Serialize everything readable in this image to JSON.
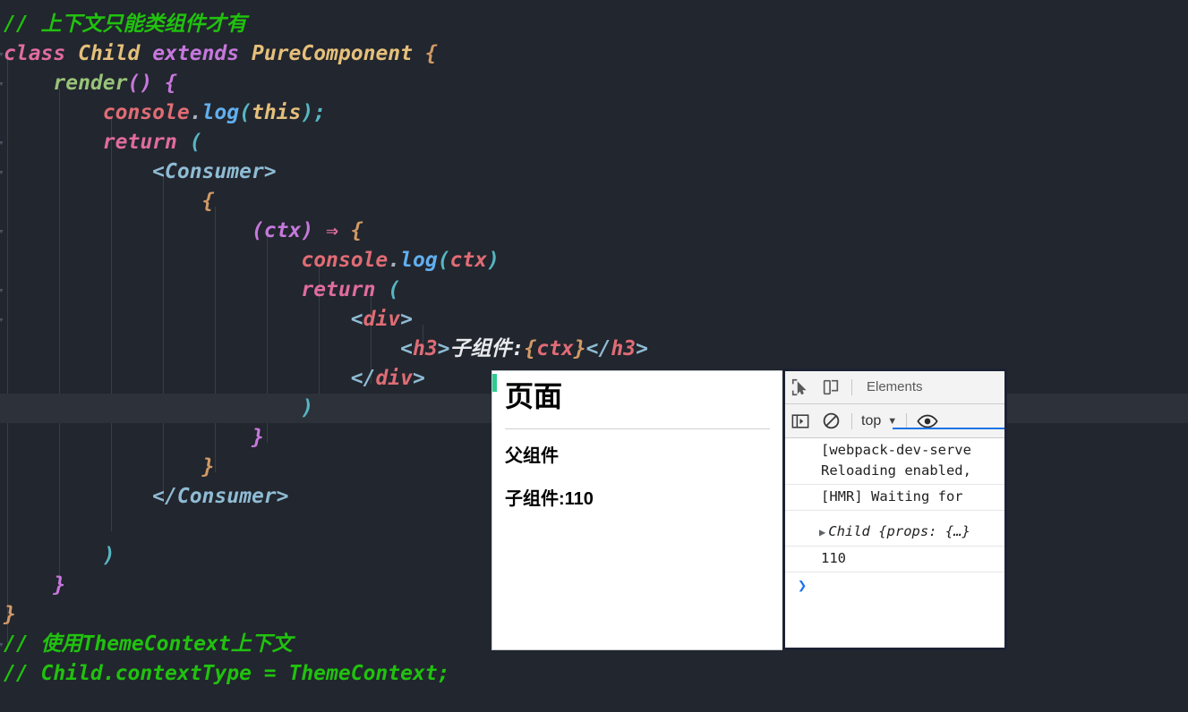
{
  "editor": {
    "theme": "One Dark",
    "bg": "#22262e",
    "highlight_bg": "#2c313a",
    "lines": [
      {
        "n": 0,
        "clipped": true,
        "fold": false,
        "tokens": []
      },
      {
        "n": 1,
        "fold": false,
        "tokens": [
          {
            "t": "// 上下文只能类组件才有",
            "c": "t-com"
          }
        ]
      },
      {
        "n": 2,
        "fold": true,
        "tokens": [
          {
            "t": "class ",
            "c": "t-kw"
          },
          {
            "t": "Child ",
            "c": "t-cls"
          },
          {
            "t": "extends ",
            "c": "t-kw2"
          },
          {
            "t": "PureComponent ",
            "c": "t-cls"
          },
          {
            "t": "{",
            "c": "t-brace"
          }
        ]
      },
      {
        "n": 3,
        "fold": true,
        "tokens": [
          {
            "t": "    ",
            "c": "t-punc"
          },
          {
            "t": "render",
            "c": "t-fn-green"
          },
          {
            "t": "()",
            "c": "t-brace2"
          },
          {
            "t": " ",
            "c": "t-punc"
          },
          {
            "t": "{",
            "c": "t-brace2"
          }
        ]
      },
      {
        "n": 4,
        "fold": false,
        "tokens": [
          {
            "t": "        ",
            "c": "t-punc"
          },
          {
            "t": "console",
            "c": "t-obj"
          },
          {
            "t": ".",
            "c": "t-punc"
          },
          {
            "t": "log",
            "c": "t-fn"
          },
          {
            "t": "(",
            "c": "t-cyan"
          },
          {
            "t": "this",
            "c": "t-this"
          },
          {
            "t": ")",
            "c": "t-cyan"
          },
          {
            "t": ";",
            "c": "t-cyan"
          }
        ]
      },
      {
        "n": 5,
        "fold": true,
        "tokens": [
          {
            "t": "        ",
            "c": "t-punc"
          },
          {
            "t": "return",
            "c": "t-kw"
          },
          {
            "t": " ",
            "c": "t-punc"
          },
          {
            "t": "(",
            "c": "t-cyan"
          }
        ]
      },
      {
        "n": 6,
        "fold": true,
        "tokens": [
          {
            "t": "            ",
            "c": "t-punc"
          },
          {
            "t": "<Consumer>",
            "c": "t-brk"
          }
        ]
      },
      {
        "n": 7,
        "fold": false,
        "tokens": [
          {
            "t": "                ",
            "c": "t-punc"
          },
          {
            "t": "{",
            "c": "t-brace"
          }
        ]
      },
      {
        "n": 8,
        "fold": true,
        "tokens": [
          {
            "t": "                    ",
            "c": "t-punc"
          },
          {
            "t": "(ctx)",
            "c": "t-brace2"
          },
          {
            "t": " ",
            "c": "t-punc"
          },
          {
            "t": "⇒",
            "c": "t-arrow"
          },
          {
            "t": " ",
            "c": "t-punc"
          },
          {
            "t": "{",
            "c": "t-brace"
          }
        ]
      },
      {
        "n": 9,
        "fold": false,
        "tokens": [
          {
            "t": "                        ",
            "c": "t-punc"
          },
          {
            "t": "console",
            "c": "t-obj"
          },
          {
            "t": ".",
            "c": "t-punc"
          },
          {
            "t": "log",
            "c": "t-fn"
          },
          {
            "t": "(",
            "c": "t-cyan"
          },
          {
            "t": "ctx",
            "c": "t-obj"
          },
          {
            "t": ")",
            "c": "t-cyan"
          }
        ]
      },
      {
        "n": 10,
        "fold": true,
        "tokens": [
          {
            "t": "                        ",
            "c": "t-punc"
          },
          {
            "t": "return",
            "c": "t-kw"
          },
          {
            "t": " ",
            "c": "t-punc"
          },
          {
            "t": "(",
            "c": "t-cyan"
          }
        ]
      },
      {
        "n": 11,
        "fold": true,
        "tokens": [
          {
            "t": "                            ",
            "c": "t-punc"
          },
          {
            "t": "<",
            "c": "t-brk"
          },
          {
            "t": "div",
            "c": "t-tag"
          },
          {
            "t": ">",
            "c": "t-brk"
          }
        ]
      },
      {
        "n": 12,
        "fold": false,
        "tokens": [
          {
            "t": "                                ",
            "c": "t-punc"
          },
          {
            "t": "<",
            "c": "t-brk"
          },
          {
            "t": "h3",
            "c": "t-tag"
          },
          {
            "t": ">",
            "c": "t-brk"
          },
          {
            "t": "子组件:",
            "c": "t-txt"
          },
          {
            "t": "{",
            "c": "t-brace"
          },
          {
            "t": "ctx",
            "c": "t-obj"
          },
          {
            "t": "}",
            "c": "t-brace"
          },
          {
            "t": "</",
            "c": "t-brk"
          },
          {
            "t": "h3",
            "c": "t-tag"
          },
          {
            "t": ">",
            "c": "t-brk"
          }
        ]
      },
      {
        "n": 13,
        "fold": false,
        "tokens": [
          {
            "t": "                            ",
            "c": "t-punc"
          },
          {
            "t": "</",
            "c": "t-brk"
          },
          {
            "t": "div",
            "c": "t-tag"
          },
          {
            "t": ">",
            "c": "t-brk"
          }
        ]
      },
      {
        "n": 14,
        "highlight": true,
        "fold": false,
        "tokens": [
          {
            "t": "                        ",
            "c": "t-punc"
          },
          {
            "t": ")",
            "c": "t-cyan"
          }
        ]
      },
      {
        "n": 15,
        "fold": false,
        "tokens": [
          {
            "t": "                    ",
            "c": "t-punc"
          },
          {
            "t": "}",
            "c": "t-brace2"
          }
        ]
      },
      {
        "n": 16,
        "fold": false,
        "tokens": [
          {
            "t": "                ",
            "c": "t-punc"
          },
          {
            "t": "}",
            "c": "t-brace"
          }
        ]
      },
      {
        "n": 17,
        "fold": false,
        "tokens": [
          {
            "t": "            ",
            "c": "t-punc"
          },
          {
            "t": "</Consumer>",
            "c": "t-brk"
          }
        ]
      },
      {
        "n": 18,
        "fold": false,
        "tokens": []
      },
      {
        "n": 19,
        "fold": false,
        "tokens": [
          {
            "t": "        ",
            "c": "t-punc"
          },
          {
            "t": ")",
            "c": "t-cyan"
          }
        ]
      },
      {
        "n": 20,
        "fold": false,
        "tokens": [
          {
            "t": "    ",
            "c": "t-punc"
          },
          {
            "t": "}",
            "c": "t-brace2"
          }
        ]
      },
      {
        "n": 21,
        "fold": false,
        "tokens": [
          {
            "t": "}",
            "c": "t-brace"
          }
        ]
      },
      {
        "n": 22,
        "fold": true,
        "tokens": [
          {
            "t": "// 使用ThemeContext上下文",
            "c": "t-com"
          }
        ]
      },
      {
        "n": 23,
        "fold": false,
        "tokens": [
          {
            "t": "// Child.contextType = ThemeContext;",
            "c": "t-com"
          }
        ]
      }
    ]
  },
  "page_preview": {
    "accent_color": "#2ecc8f",
    "title": "页面",
    "parent_label": "父组件",
    "child_label": "子组件:110"
  },
  "devtools": {
    "accent_color": "#1a73e8",
    "tabbar": {
      "inspect_icon": "inspect-element-icon",
      "device_icon": "device-toolbar-icon",
      "tabs": [
        {
          "label": "Elements",
          "active": false
        }
      ]
    },
    "console_toolbar": {
      "sidebar_icon": "console-sidebar-icon",
      "clear_icon": "clear-console-icon",
      "context_selector": "top",
      "caret": "▼",
      "eye_icon": "live-expression-icon"
    },
    "console_messages": [
      {
        "text": "[webpack-dev-serve",
        "second_line": "Reloading enabled,",
        "type": "log"
      },
      {
        "text": "[HMR] Waiting for",
        "type": "log"
      },
      {
        "text": "Child {props: {…}",
        "type": "object",
        "triangle": "▶"
      },
      {
        "text": "110",
        "type": "log"
      }
    ],
    "prompt_symbol": "❯"
  }
}
